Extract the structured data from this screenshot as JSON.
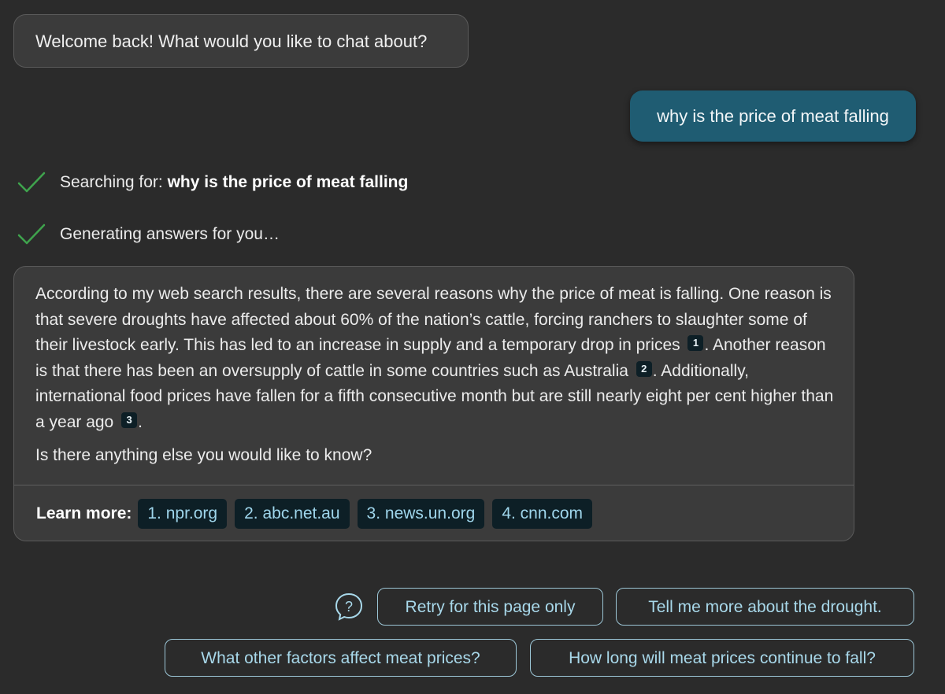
{
  "welcome": {
    "text": "Welcome back! What would you like to chat about?"
  },
  "user_message": {
    "text": "why is the price of meat falling"
  },
  "status": [
    {
      "prefix": "Searching for: ",
      "query": "why is the price of meat falling",
      "icon": "check-icon"
    },
    {
      "prefix": "Generating answers for you…",
      "icon": "check-icon"
    }
  ],
  "answer": {
    "seg1": "According to my web search results, there are several reasons why the price of meat is falling. One reason is that severe droughts have affected about 60% of the nation’s cattle, forcing ranchers to slaughter some of their livestock early. This has led to an increase in supply and a temporary drop in prices",
    "ref1": "1",
    "seg2": ". Another reason is that there has been an oversupply of cattle in some countries such as Australia",
    "ref2": "2",
    "seg3": ". Additionally, international food prices have fallen for a fifth consecutive month but are still nearly eight per cent higher than a year ago",
    "ref3": "3",
    "seg4": ".",
    "followup": "Is there anything else you would like to know?"
  },
  "learn_more": {
    "label": "Learn more:",
    "links": [
      "1. npr.org",
      "2. abc.net.au",
      "3. news.un.org",
      "4. cnn.com"
    ]
  },
  "suggestions": {
    "retry": "Retry for this page only",
    "drought": "Tell me more about the drought.",
    "factors": "What other factors affect meat prices?",
    "how_long": "How long will meat prices continue to fall?"
  },
  "colors": {
    "background": "#2b2b2b",
    "bot_bubble": "#3b3b3b",
    "user_bubble": "#1f5c72",
    "check": "#3fa34d",
    "link_text": "#9fd6ec"
  }
}
